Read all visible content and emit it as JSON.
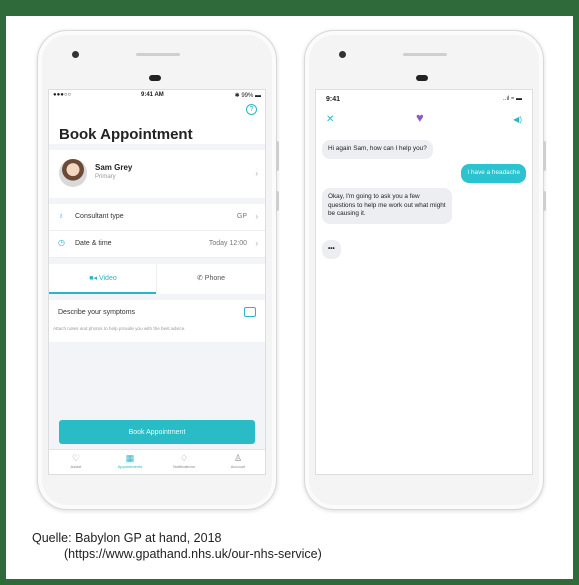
{
  "left_phone": {
    "status": {
      "carrier": "●●●○○",
      "time": "9:41 AM",
      "battery": "✱ 99% ▬"
    },
    "title": "Book Appointment",
    "profile": {
      "name": "Sam Grey",
      "subtitle": "Primary"
    },
    "rows": [
      {
        "label": "Consultant type",
        "value": "GP"
      },
      {
        "label": "Date & time",
        "value": "Today 12:00"
      }
    ],
    "toggle": {
      "video": "Video",
      "phone": "Phone"
    },
    "symptoms": {
      "title": "Describe your symptoms",
      "hint": "Attach notes and photos to help provide you with the best advice."
    },
    "book_button": "Book Appointment",
    "tabs": [
      "Assist",
      "Appointments",
      "Notifications",
      "Account"
    ]
  },
  "right_phone": {
    "status": {
      "time": "9:41",
      "signal": "..ıl ≈ ▬"
    },
    "messages": [
      {
        "from": "bot",
        "text": "Hi again Sam, how can I help you?"
      },
      {
        "from": "me",
        "text": "I have a headache"
      },
      {
        "from": "bot",
        "text": "Okay, I'm going to ask you a few questions to help me work out what might be causing it."
      },
      {
        "from": "bot",
        "text": "•••"
      }
    ]
  },
  "caption": {
    "line1": "Quelle: Babylon GP at hand, 2018",
    "line2": "(https://www.gpathand.nhs.uk/our-nhs-service)"
  },
  "colors": {
    "accent": "#2bb5c8",
    "frame": "#2f6b3a",
    "heart": "#8b5cc8"
  }
}
